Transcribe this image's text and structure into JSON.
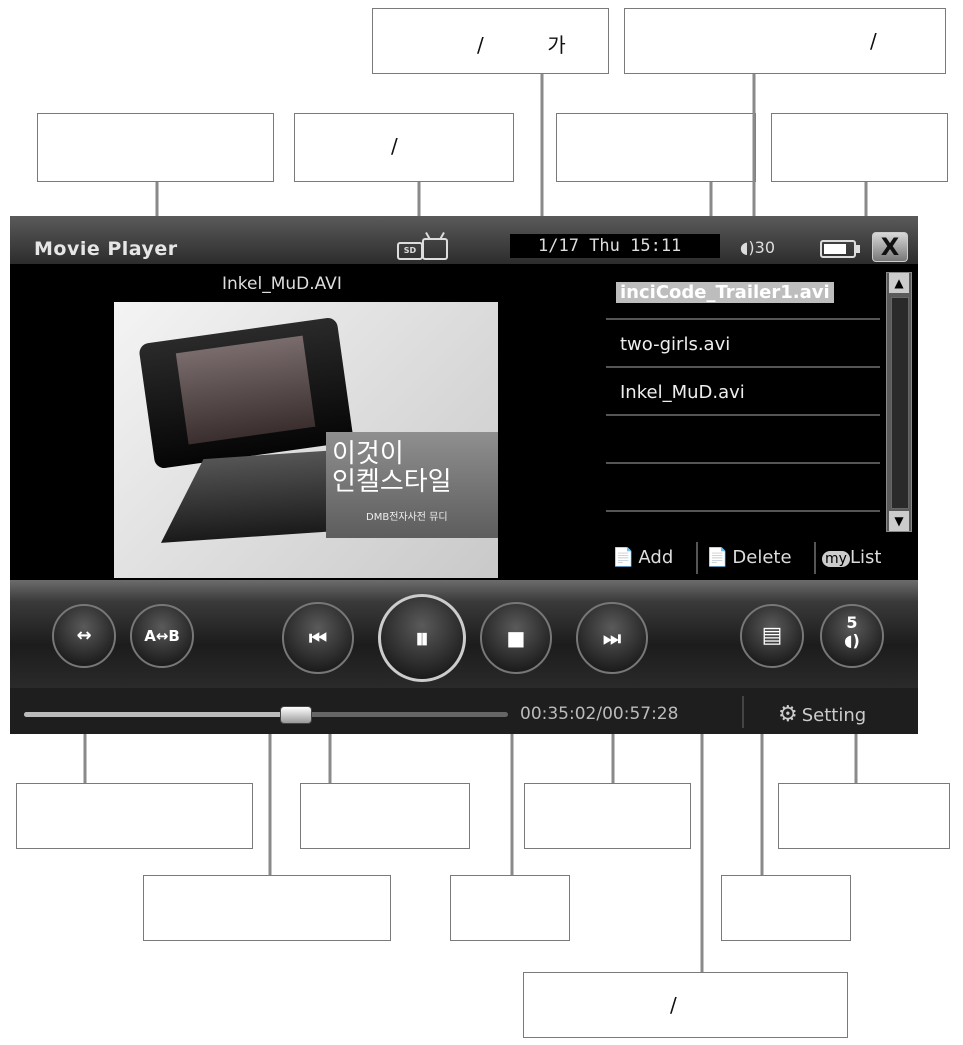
{
  "callouts": {
    "add_caption": "/          가",
    "delete_caption": "/",
    "pause_caption": "/",
    "time_caption": "/"
  },
  "player": {
    "app_title": "Movie Player",
    "sd_badge": "SD",
    "clock": "1/17 Thu 15:11",
    "volume_label": "30",
    "close_label": "X",
    "now_playing": "Inkel_MuD.AVI",
    "video_text_line1": "이것이",
    "video_text_line2": "인켈스타일",
    "video_text_small": "DMB전자사전 뮤디",
    "playlist": [
      {
        "name": "inciCode_Trailer1.avi",
        "selected": true
      },
      {
        "name": "two-girls.avi",
        "selected": false
      },
      {
        "name": "Inkel_MuD.avi",
        "selected": false
      }
    ],
    "list_buttons": {
      "add": "Add",
      "delete": "Delete",
      "my": "my",
      "list": "List"
    },
    "controls": {
      "repeat_ab": "A↔B",
      "volume_level": "5"
    },
    "progress": 0.56,
    "time_display": "00:35:02/00:57:28",
    "setting_label": "Setting"
  }
}
